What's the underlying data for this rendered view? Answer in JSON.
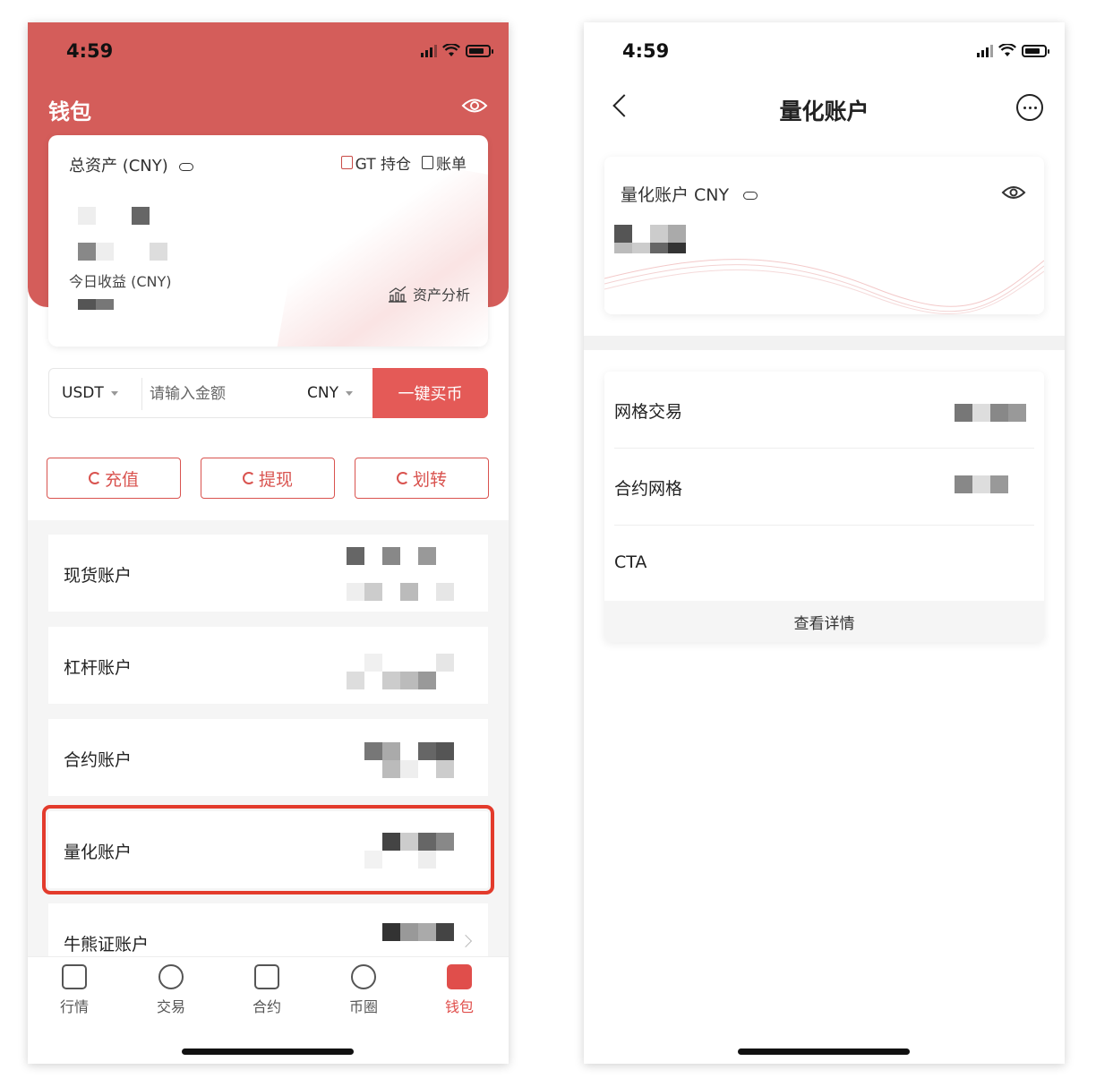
{
  "left": {
    "status_time": "4:59",
    "title": "钱包",
    "total_assets_label": "总资产 (CNY)",
    "gt_holdings_label": "GT 持仓",
    "bill_label": "账单",
    "today_income_label": "今日收益 (CNY)",
    "asset_analysis_label": "资产分析",
    "buy": {
      "coin": "USDT",
      "amount_placeholder": "请输入金额",
      "fiat": "CNY",
      "button": "一键买币"
    },
    "actions": {
      "deposit": "充值",
      "withdraw": "提现",
      "transfer": "划转"
    },
    "accounts": [
      {
        "name": "现货账户"
      },
      {
        "name": "杠杆账户"
      },
      {
        "name": "合约账户"
      },
      {
        "name": "量化账户",
        "highlighted": true
      },
      {
        "name": "牛熊证账户"
      }
    ],
    "tabs": [
      {
        "label": "行情",
        "icon": "chart-icon"
      },
      {
        "label": "交易",
        "icon": "exchange-icon"
      },
      {
        "label": "合约",
        "icon": "contract-icon"
      },
      {
        "label": "币圈",
        "icon": "chat-icon"
      },
      {
        "label": "钱包",
        "icon": "wallet-icon",
        "active": true
      }
    ]
  },
  "right": {
    "status_time": "4:59",
    "title": "量化账户",
    "card_label": "量化账户 CNY",
    "strategies": [
      {
        "name": "网格交易"
      },
      {
        "name": "合约网格"
      },
      {
        "name": "CTA"
      }
    ],
    "detail_button": "查看详情"
  },
  "colors": {
    "brand_red": "#d45d5a",
    "button_red": "#e45a57",
    "highlight_red": "#e33b2c"
  }
}
